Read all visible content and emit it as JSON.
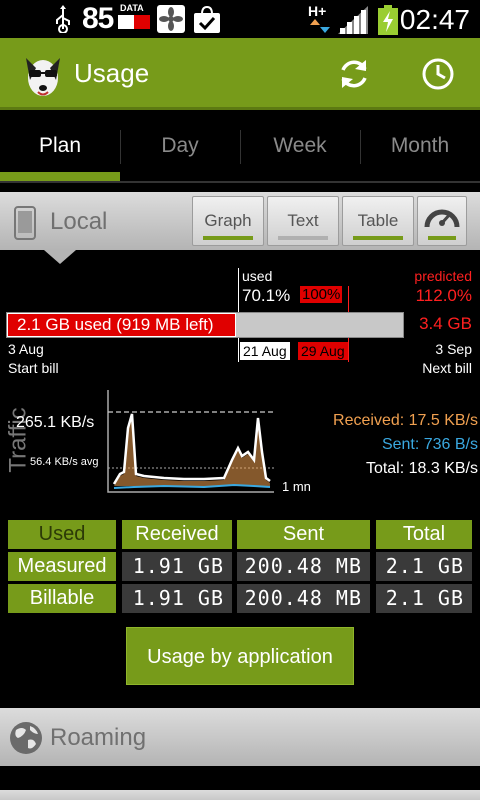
{
  "status": {
    "battery_level": "85",
    "data_label": "DATA",
    "network_type": "H+",
    "time": "02:47"
  },
  "appbar": {
    "title": "Usage"
  },
  "tabs": [
    {
      "label": "Plan"
    },
    {
      "label": "Day"
    },
    {
      "label": "Week"
    },
    {
      "label": "Month"
    }
  ],
  "local": {
    "title": "Local",
    "views": [
      {
        "label": "Graph"
      },
      {
        "label": "Text"
      },
      {
        "label": "Table"
      }
    ],
    "plan": {
      "used_label": "used",
      "used_pct": "70.1%",
      "limit_pct": "100%",
      "predicted_label": "predicted",
      "predicted_pct": "112.0%",
      "used_text": "2.1 GB used (919 MB left)",
      "predicted_amount": "3.4 GB",
      "used_fraction": 0.701,
      "limit_fraction": 1.0,
      "start_date": "3 Aug",
      "start_label": "Start bill",
      "today_date": "21 Aug",
      "limit_date": "29 Aug",
      "end_date": "3 Sep",
      "end_label": "Next bill"
    },
    "traffic": {
      "axis_label": "Traffic",
      "peak_label": "265.1 KB/s",
      "avg_label": "56.4 KB/s avg",
      "time_label": "1 mn",
      "received": "Received: 17.5 KB/s",
      "sent": "Sent: 736 B/s",
      "total": "Total: 18.3 KB/s",
      "colors": {
        "received": "#f0a050",
        "sent": "#3aa8e0",
        "total": "#ffffff"
      }
    },
    "table": {
      "headers": [
        "Used",
        "Received",
        "Sent",
        "Total"
      ],
      "rows": [
        {
          "label": "Measured",
          "values": [
            "1.91 GB",
            "200.48 MB",
            "2.1 GB"
          ]
        },
        {
          "label": "Billable",
          "values": [
            "1.91 GB",
            "200.48 MB",
            "2.1 GB"
          ]
        }
      ]
    },
    "app_button": "Usage by application"
  },
  "roaming": {
    "title": "Roaming"
  },
  "colors": {
    "accent": "#779b1a",
    "over": "#e00000",
    "predicted": "#ff2020",
    "received": "#f0a050",
    "sent": "#3aa8e0"
  }
}
